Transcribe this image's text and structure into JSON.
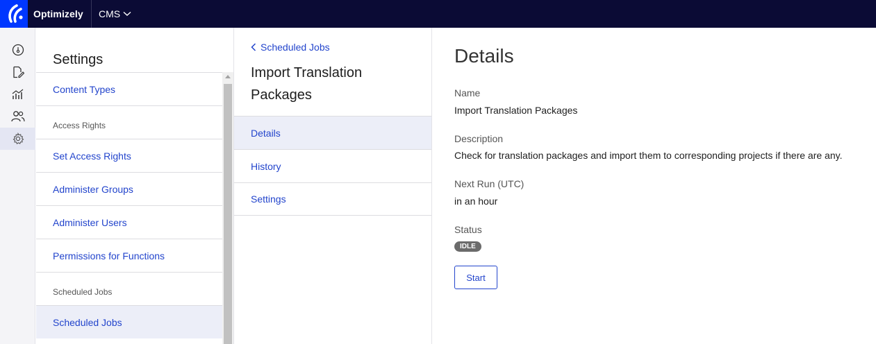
{
  "topbar": {
    "brand": "Optimizely",
    "product": "CMS",
    "product_icon": "chevron-down-icon"
  },
  "rail": {
    "items": [
      {
        "name": "dashboard",
        "icon": "dashboard-icon"
      },
      {
        "name": "edit",
        "icon": "edit-document-icon"
      },
      {
        "name": "reports",
        "icon": "analytics-icon"
      },
      {
        "name": "users",
        "icon": "users-icon"
      },
      {
        "name": "settings",
        "icon": "gear-icon",
        "active": true
      }
    ]
  },
  "settings": {
    "title": "Settings",
    "content_types": "Content Types",
    "access_rights_section": "Access Rights",
    "access_rights_items": [
      "Set Access Rights",
      "Administer Groups",
      "Administer Users",
      "Permissions for Functions"
    ],
    "scheduled_jobs_section": "Scheduled Jobs",
    "scheduled_jobs_item": "Scheduled Jobs"
  },
  "job": {
    "back_label": "Scheduled Jobs",
    "title": "Import Translation Packages",
    "tabs": [
      {
        "label": "Details",
        "selected": true
      },
      {
        "label": "History"
      },
      {
        "label": "Settings"
      }
    ]
  },
  "details": {
    "heading": "Details",
    "name_label": "Name",
    "name_value": "Import Translation Packages",
    "description_label": "Description",
    "description_value": "Check for translation packages and import them to corresponding projects if there are any.",
    "next_run_label": "Next Run (UTC)",
    "next_run_value": "in an hour",
    "status_label": "Status",
    "status_value": "IDLE",
    "start_button": "Start"
  },
  "colors": {
    "topbar": "#0b0b35",
    "logo_bg": "#0037ff",
    "link": "#2244cc",
    "selected_row": "#eceef8",
    "badge": "#6b6b6b"
  }
}
